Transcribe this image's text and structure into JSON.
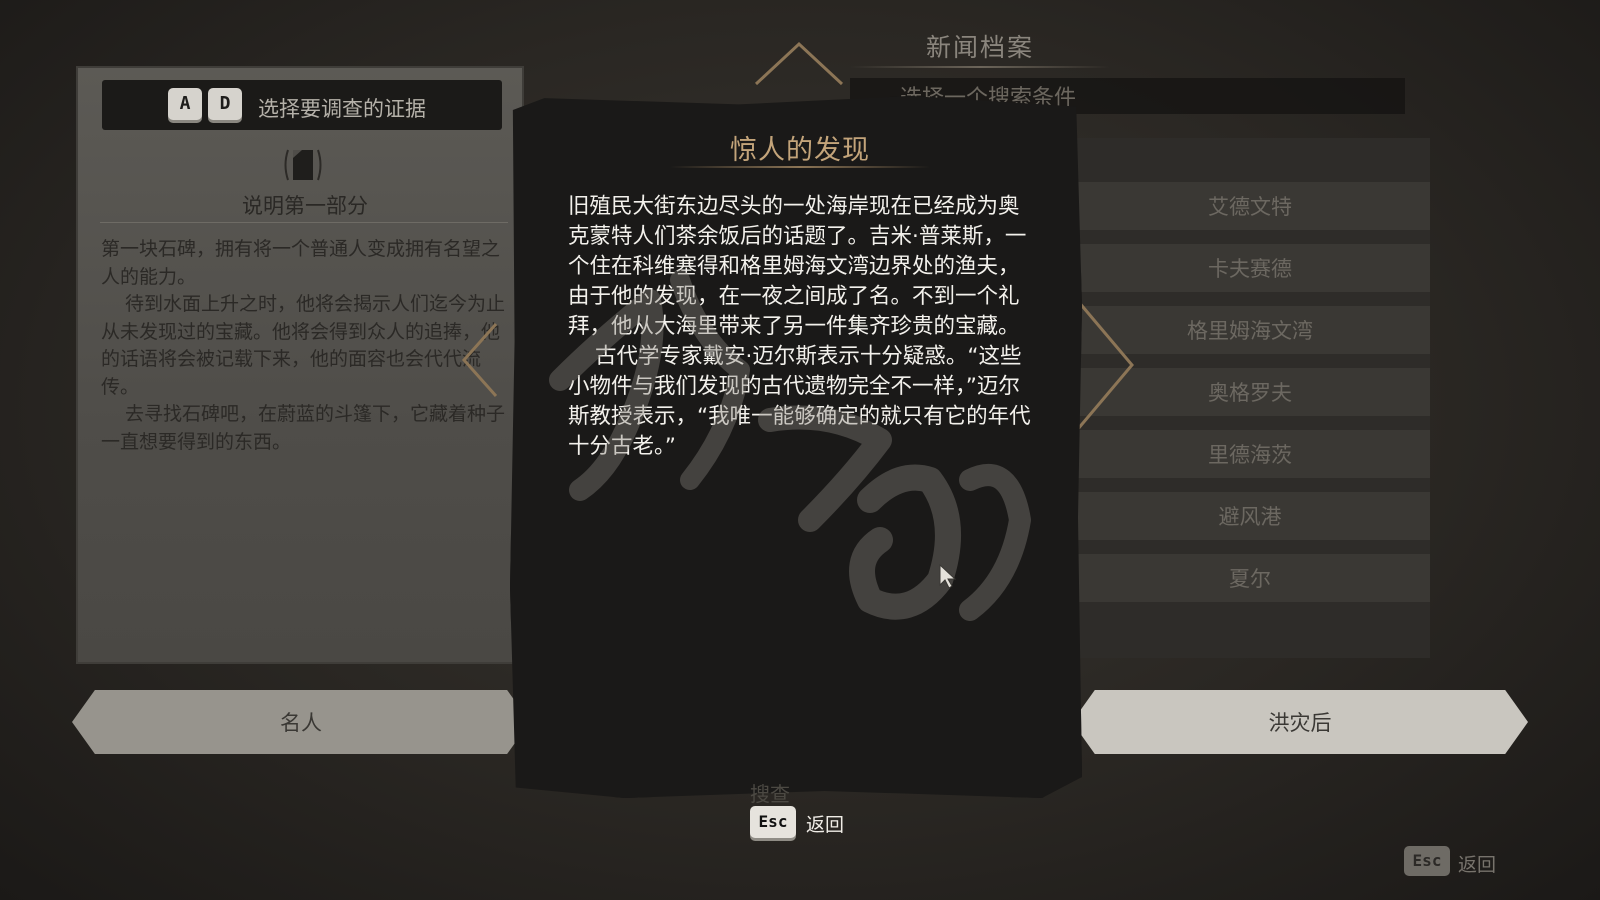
{
  "background_header": {
    "title": "新闻档案",
    "subtitle": "选择一个搜索条件"
  },
  "evidence_panel": {
    "key_prev": "A",
    "key_next": "D",
    "instruction": "选择要调查的证据",
    "document_title": "说明第一部分",
    "document_paragraphs": [
      "第一块石碑，拥有将一个普通人变成拥有名望之人的能力。",
      "待到水面上升之时，他将会揭示人们迄今为止从未发现过的宝藏。他将会得到众人的追捧，他的话语将会被记载下来，他的面容也会代代流传。",
      "去寻找石碑吧，在蔚蓝的斗篷下，它藏着种子一直想要得到的东西。"
    ],
    "banner_label": "名人"
  },
  "location_list": {
    "items": [
      "艾德文特",
      "卡夫赛德",
      "格里姆海文湾",
      "奥格罗夫",
      "里德海茨",
      "避风港",
      "夏尔"
    ],
    "banner_label": "洪灾后"
  },
  "article_modal": {
    "title": "惊人的发现",
    "paragraphs": [
      "旧殖民大街东边尽头的一处海岸现在已经成为奥克蒙特人们茶余饭后的话题了。吉米·普莱斯，一个住在科维塞得和格里姆海文湾边界处的渔夫，由于他的发现，在一夜之间成了名。不到一个礼拜，他从大海里带来了另一件集齐珍贵的宝藏。",
      "古代学专家戴安·迈尔斯表示十分疑惑。“这些小物件与我们发现的古代遗物完全不一样，”迈尔斯教授表示，“我唯一能够确定的就只有它的年代十分古老。”"
    ]
  },
  "prompts": {
    "hidden_prompt": "搜查",
    "esc_key": "Esc",
    "esc_label": "返回",
    "bg_esc_key": "Esc",
    "bg_esc_label": "返回"
  },
  "colors": {
    "modal_title": "#c3a47a",
    "accent_gold": "#8c7556"
  }
}
